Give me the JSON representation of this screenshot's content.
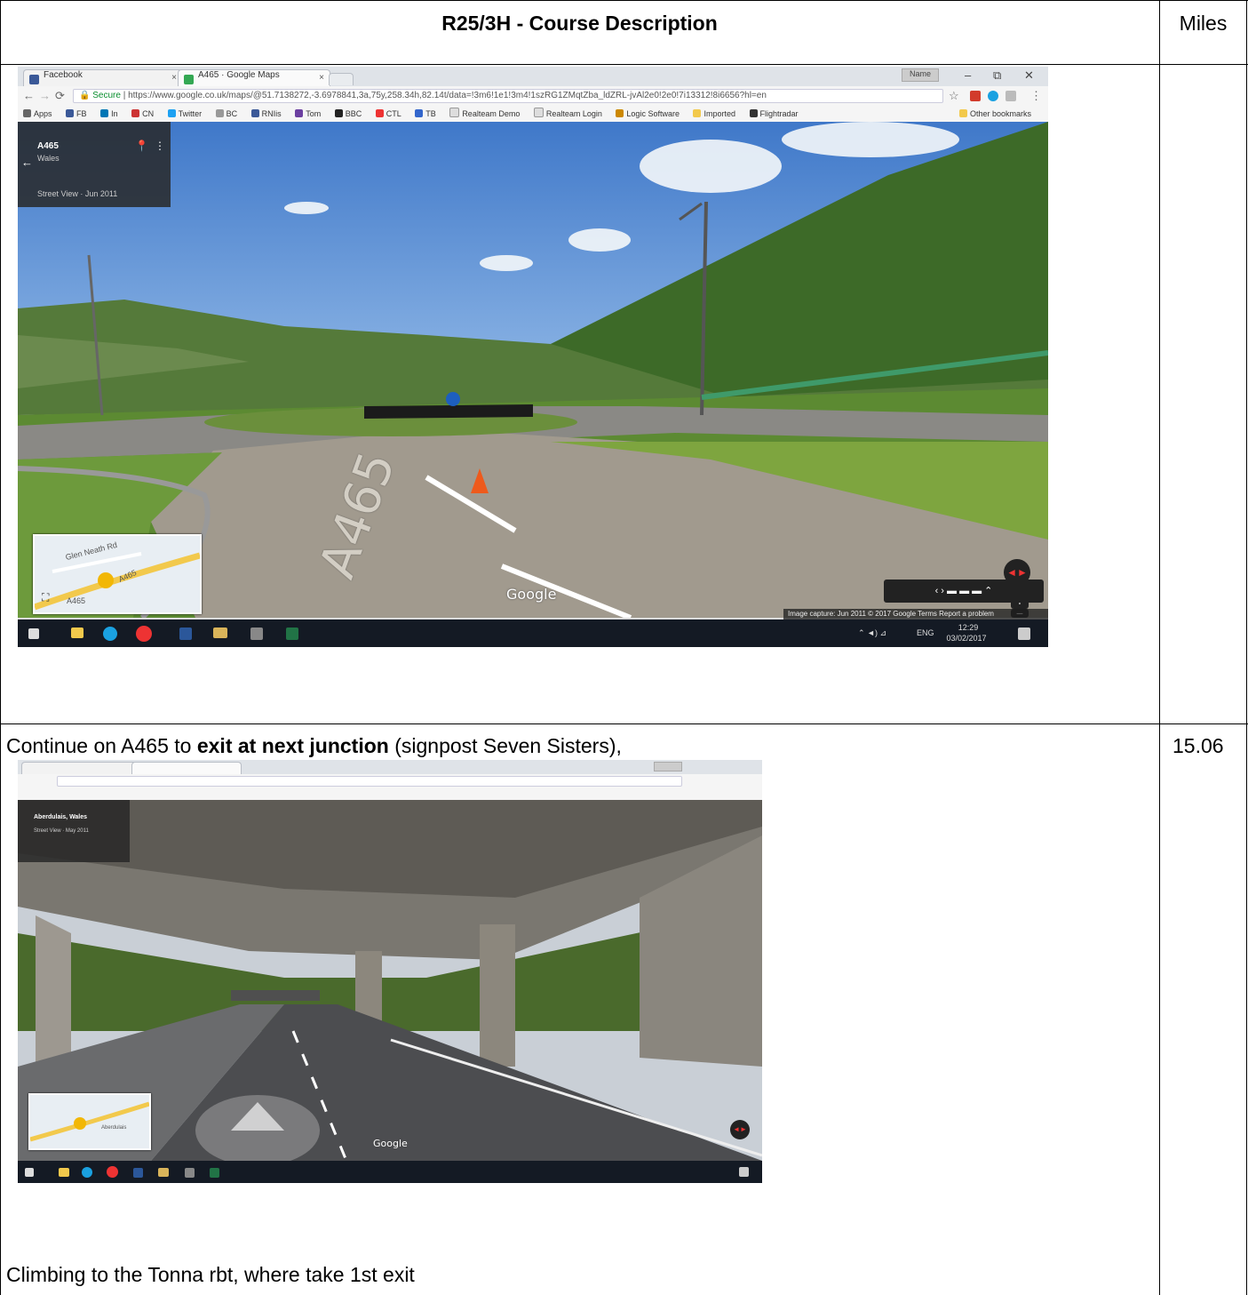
{
  "table": {
    "header_description": "R25/3H - Course Description",
    "header_miles": "Miles",
    "row2_text_before": "Continue on A465 to ",
    "row2_text_bold": "exit at next junction",
    "row2_text_after": " (signpost Seven Sisters),",
    "row2_miles": "15.06",
    "row2_caption": "Climbing to the Tonna rbt, where take 1st exit"
  },
  "screenshot1": {
    "tabs": [
      {
        "label": "Facebook",
        "close": "×"
      },
      {
        "label": "A465 · Google Maps",
        "close": "×"
      }
    ],
    "user_badge": "Name",
    "window_controls": [
      "–",
      "⧉",
      "✕"
    ],
    "url_secure": "Secure",
    "url": "https://www.google.co.uk/maps/@51.7138272,-3.6978841,3a,75y,258.34h,82.14t/data=!3m6!1e1!3m4!1szRG1ZMqtZba_ldZRL-jvAl2e0!2e0!7i13312!8i6656?hl=en",
    "bookmarks": [
      "Apps",
      "FB",
      "In",
      "CN",
      "Twitter",
      "BC",
      "RNIis",
      "Tom",
      "BBC",
      "CTL",
      "TB",
      "Realteam Demo",
      "Realteam Login",
      "Logic Software",
      "Imported",
      "Flightradar"
    ],
    "other_bookmarks": "Other bookmarks",
    "place_title": "A465",
    "place_sub": "Wales",
    "sv_date": "Street View · Jun 2011",
    "road_marking": "A465",
    "map_labels": [
      "Glen Neath Rd",
      "A465",
      "A465"
    ],
    "google_watermark": "Google",
    "caption_bar": "Image capture: Jun 2011   © 2017 Google   Terms   Report a problem",
    "tray_lang": "ENG",
    "tray_time": "12:29",
    "tray_date": "03/02/2017"
  },
  "screenshot2": {
    "place_title": "Aberdulais, Wales",
    "sv_date": "Street View · May 2011",
    "google_watermark": "Google",
    "map_labels": [
      "Aberdulais"
    ]
  },
  "colors": {
    "sky": "#5f95d6",
    "forest": "#3f6a2a",
    "road": "#9b958b",
    "taskbar": "#141a24"
  }
}
